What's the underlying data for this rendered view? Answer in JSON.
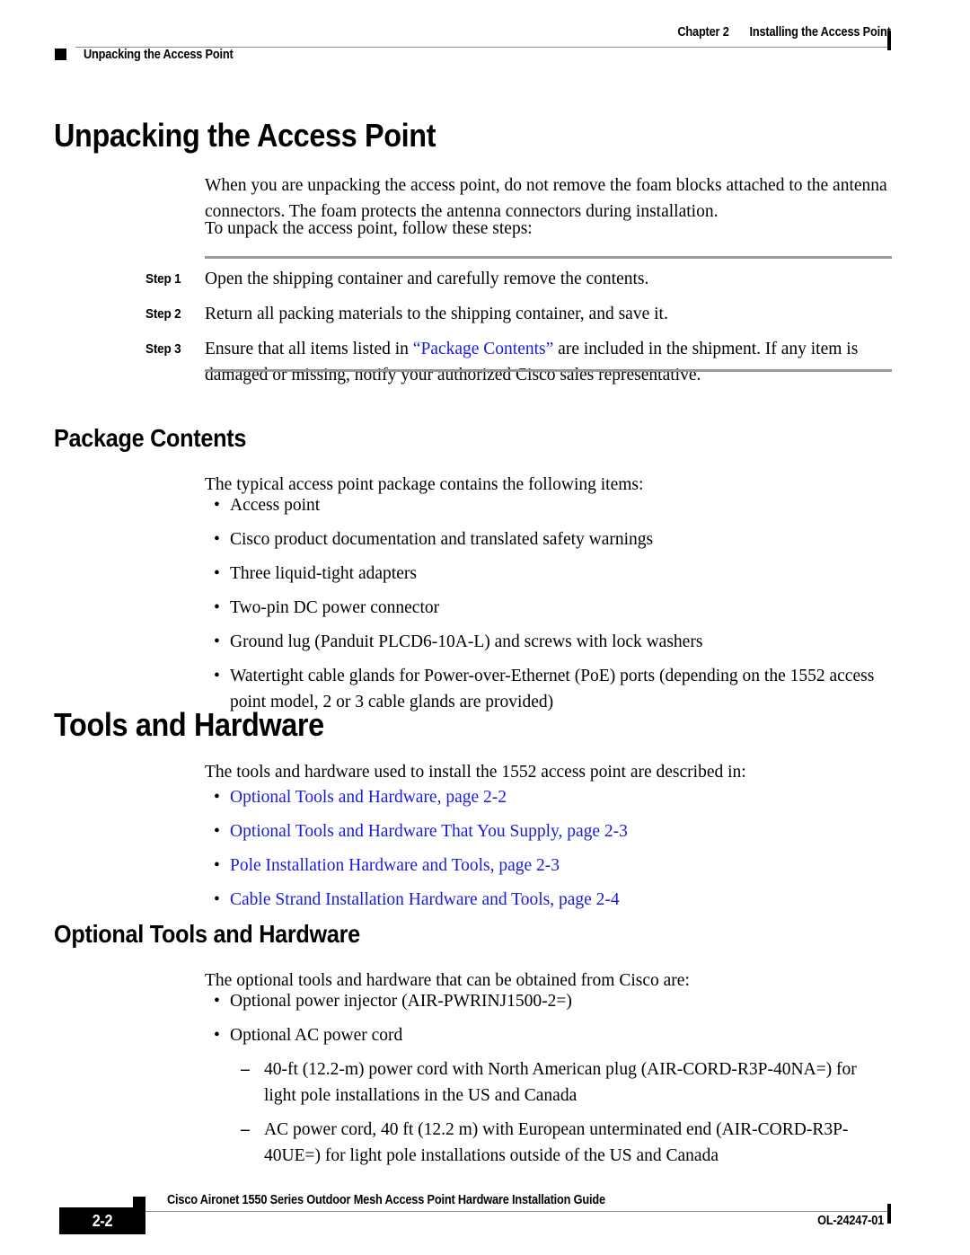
{
  "header": {
    "chapter_label": "Chapter 2",
    "chapter_title": "Installing the Access Point",
    "running_title": "Unpacking the Access Point"
  },
  "sections": {
    "unpacking": {
      "heading": "Unpacking the Access Point",
      "paragraph_1": "When you are unpacking the access point, do not remove the foam blocks attached to the antenna connectors. The foam protects the antenna connectors during installation.",
      "paragraph_2": "To unpack the access point, follow these steps:",
      "steps": [
        {
          "label": "Step 1",
          "text": "Open the shipping container and carefully remove the contents."
        },
        {
          "label": "Step 2",
          "text": "Return all packing materials to the shipping container, and save it."
        },
        {
          "label": "Step 3",
          "text_before": "Ensure that all items listed in ",
          "link": "“Package Contents”",
          "text_after": " are included in the shipment. If any item is damaged or missing, notify your authorized Cisco sales representative."
        }
      ]
    },
    "package_contents": {
      "heading": "Package Contents",
      "intro": "The typical access point package contains the following items:",
      "items": [
        "Access point",
        "Cisco product documentation and translated safety warnings",
        "Three liquid-tight adapters",
        "Two-pin DC power connector",
        "Ground lug (Panduit PLCD6-10A-L) and screws with lock washers",
        "Watertight cable glands for Power-over-Ethernet (PoE) ports (depending on the 1552 access point model, 2 or 3 cable glands are provided)"
      ]
    },
    "tools_and_hardware": {
      "heading": "Tools and Hardware",
      "intro": "The tools and hardware used to install the 1552 access point are described in:",
      "links": [
        "Optional Tools and Hardware, page 2-2",
        "Optional Tools and Hardware That You Supply, page 2-3",
        "Pole Installation Hardware and Tools, page 2-3",
        "Cable Strand Installation Hardware and Tools, page 2-4"
      ]
    },
    "optional_tools": {
      "heading": "Optional Tools and Hardware",
      "intro": "The optional tools and hardware that can be obtained from Cisco are:",
      "items": [
        "Optional power injector (AIR-PWRINJ1500-2=)",
        "Optional AC power cord"
      ],
      "sub_items": [
        "40-ft (12.2-m) power cord with North American plug (AIR-CORD-R3P-40NA=) for light pole installations in the US and Canada",
        "AC power cord, 40 ft (12.2 m) with European unterminated end (AIR-CORD-R3P-40UE=) for light pole installations outside of the US and Canada"
      ]
    }
  },
  "marks": {
    "bullet": "•",
    "dash": "–"
  },
  "footer": {
    "page_number": "2-2",
    "guide_title": "Cisco Aironet 1550 Series Outdoor Mesh Access Point Hardware Installation Guide",
    "doc_id": "OL-24247-01"
  },
  "colors": {
    "xref_blue": "#1a1ae0",
    "rule_gray": "#9a9a9a",
    "ink": "#000000"
  }
}
